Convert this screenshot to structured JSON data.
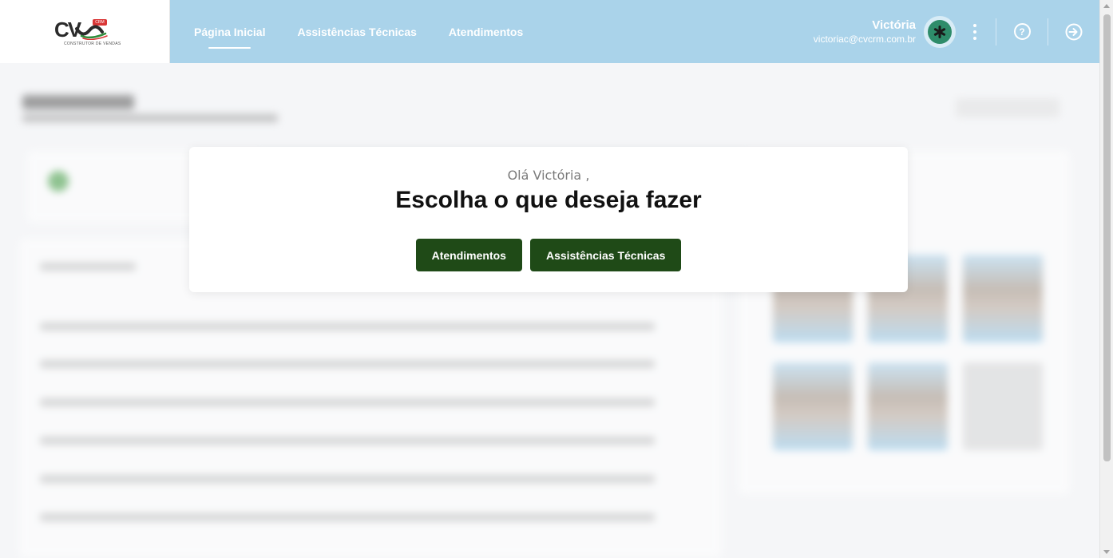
{
  "header": {
    "logo": {
      "text": "CV",
      "badge": "CRM",
      "tagline": "CONSTRUTOR DE VENDAS"
    },
    "nav": [
      {
        "label": "Página Inicial",
        "active": true
      },
      {
        "label": "Assistências Técnicas",
        "active": false
      },
      {
        "label": "Atendimentos",
        "active": false
      }
    ],
    "user": {
      "name": "Victória",
      "email": "victoriac@cvcrm.com.br",
      "avatar_icon": "asterisk-icon"
    },
    "help_icon": "question-circle-icon",
    "help_glyph": "?",
    "logout_icon": "logout-icon",
    "accent_color": "#aad3ea"
  },
  "dialog": {
    "greeting": "Olá Victória ,",
    "title": "Escolha o que deseja fazer",
    "buttons": [
      {
        "label": "Atendimentos"
      },
      {
        "label": "Assistências Técnicas"
      }
    ],
    "button_color": "#1f4a17"
  }
}
